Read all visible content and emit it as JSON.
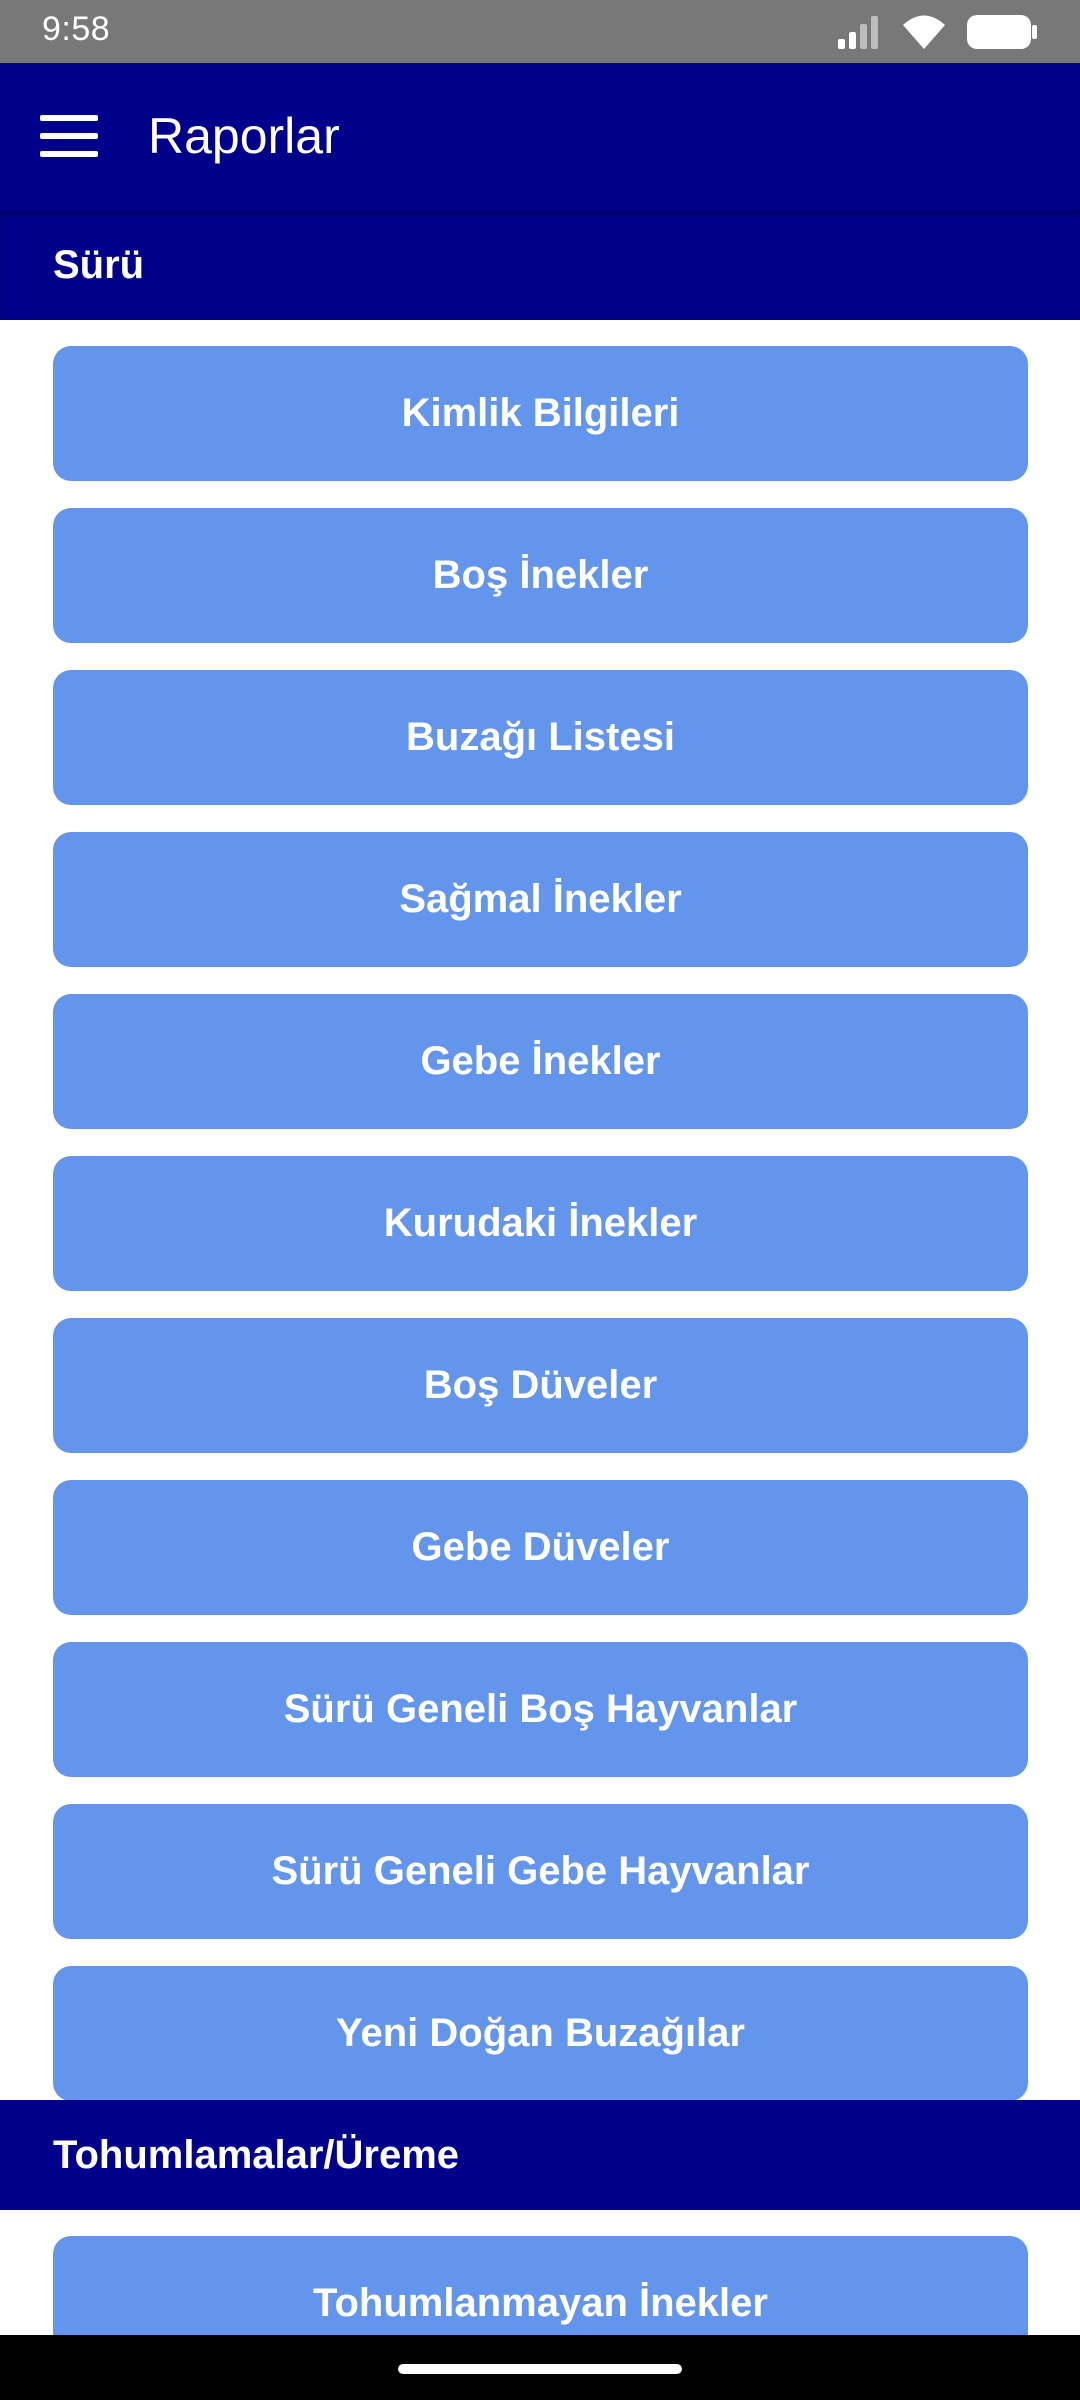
{
  "status_bar": {
    "time": "9:58",
    "icons": [
      "signal-icon",
      "wifi-icon",
      "battery-icon"
    ]
  },
  "app_bar": {
    "title": "Raporlar",
    "menu_icon": "hamburger-menu-icon"
  },
  "sections": [
    {
      "title": "Sürü",
      "items": [
        "Kimlik Bilgileri",
        "Boş İnekler",
        "Buzağı Listesi",
        "Sağmal İnekler",
        "Gebe İnekler",
        "Kurudaki İnekler",
        "Boş Düveler",
        "Gebe Düveler",
        "Sürü Geneli Boş Hayvanlar",
        "Sürü Geneli Gebe Hayvanlar",
        "Yeni Doğan Buzağılar"
      ]
    },
    {
      "title": "Tohumlamalar/Üreme",
      "items": [
        "Tohumlanmayan İnekler"
      ]
    }
  ],
  "colors": {
    "primary": "#00008b",
    "button": "#6495ed",
    "status_bar": "#787878"
  }
}
